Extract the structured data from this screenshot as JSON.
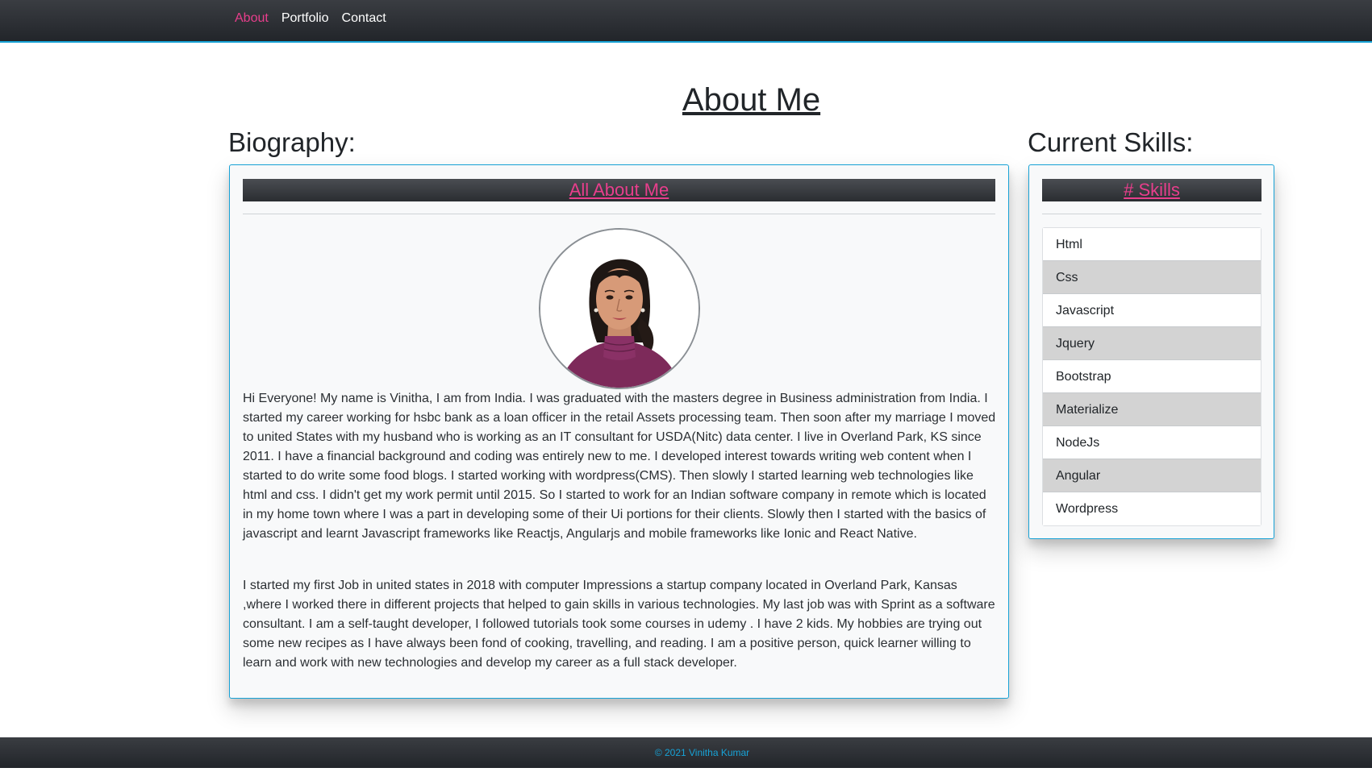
{
  "nav": {
    "items": [
      {
        "label": "About",
        "active": true
      },
      {
        "label": "Portfolio",
        "active": false
      },
      {
        "label": "Contact",
        "active": false
      }
    ]
  },
  "page": {
    "title": "About Me"
  },
  "biography": {
    "heading": "Biography:",
    "card_title": "All About Me",
    "paragraphs": [
      "Hi Everyone! My name is Vinitha, I am from India. I was graduated with the masters degree in Business administration from India. I started my career working for hsbc bank as a loan officer in the retail Assets processing team. Then soon after my marriage I moved to united States with my husband who is working as an IT consultant for USDA(Nitc) data center. I live in Overland Park, KS since 2011. I have a financial background and coding was entirely new to me. I developed interest towards writing web content when I started to do write some food blogs. I started working with wordpress(CMS). Then slowly I started learning web technologies like html and css. I didn't get my work permit until 2015. So I started to work for an Indian software company in remote which is located in my home town where I was a part in developing some of their Ui portions for their clients. Slowly then I started with the basics of javascript and learnt Javascript frameworks like Reactjs, Angularjs and mobile frameworks like Ionic and React Native.",
      "I started my first Job in united states in 2018 with computer Impressions a startup company located in Overland Park, Kansas ,where I worked there in different projects that helped to gain skills in various technologies. My last job was with Sprint as a software consultant. I am a self-taught developer, I followed tutorials took some courses in udemy . I have 2 kids. My hobbies are trying out some new recipes as I have always been fond of cooking, travelling, and reading. I am a positive person, quick learner willing to learn and work with new technologies and develop my career as a full stack developer."
    ]
  },
  "skills": {
    "heading": "Current Skills:",
    "card_title": "# Skills",
    "items": [
      "Html",
      "Css",
      "Javascript",
      "Jquery",
      "Bootstrap",
      "Materialize",
      "NodeJs",
      "Angular",
      "Wordpress"
    ]
  },
  "footer": {
    "text": "© 2021 Vinitha Kumar"
  },
  "colors": {
    "accent_pink": "#e83e8c",
    "accent_blue": "#17a2d6",
    "navbar_dark": "#2a2d31"
  }
}
